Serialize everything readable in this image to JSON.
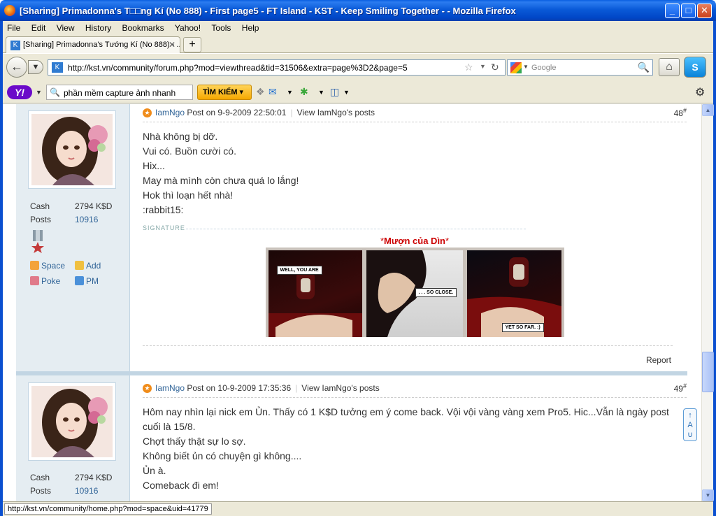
{
  "window": {
    "title": "[Sharing] Primadonna's T□□ng Kí (No 888) - First page5 - FT Island - KST - Keep Smiling Together - - Mozilla Firefox",
    "min": "_",
    "max": "□",
    "close": "✕"
  },
  "menu": [
    "File",
    "Edit",
    "View",
    "History",
    "Bookmarks",
    "Yahoo!",
    "Tools",
    "Help"
  ],
  "tab": {
    "label": "[Sharing] Primadonna's Tướng Kí (No 888) - ...",
    "close": "✕",
    "new": "+"
  },
  "nav": {
    "url": "http://kst.vn/community/forum.php?mod=viewthread&tid=31506&extra=page%3D2&page=5",
    "search_placeholder": "Google"
  },
  "yahoo": {
    "logo": "Y!",
    "search_value": "phần mềm capture ảnh nhanh",
    "search_button": "TÌM KIẾM ▾"
  },
  "posts": [
    {
      "author": "IamNgo",
      "posted": " Post on 9-9-2009 22:50:01",
      "view_posts": "View IamNgo's posts",
      "floor": "48",
      "cash_label": "Cash",
      "cash_value": "2794 K$D",
      "posts_label": "Posts",
      "posts_value": "10916",
      "actions": [
        "Space",
        "Add",
        "Poke",
        "PM"
      ],
      "lines": [
        "Nhà không bị dỡ.",
        "Vui có. Buồn cười có.",
        "Hix...",
        "May mà mình còn chưa quá lo lắng!",
        "Hok thì loạn hết nhà!",
        ":rabbit15:"
      ],
      "signature_label": "SIGNATURE",
      "signature_title": "Mượn của Dìn",
      "comic_bubbles": [
        "WELL, YOU ARE",
        ". . . SO CLOSE.",
        "YET SO FAR. :)"
      ],
      "report": "Report"
    },
    {
      "author": "IamNgo",
      "posted": " Post on 10-9-2009 17:35:36",
      "view_posts": "View IamNgo's posts",
      "floor": "49",
      "cash_label": "Cash",
      "cash_value": "2794 K$D",
      "posts_label": "Posts",
      "posts_value": "10916",
      "lines": [
        "Hôm nay nhìn lại nick em Ủn. Thấy có 1 K$D tưởng em ý come back. Vội vội vàng vàng xem Pro5. Hic...Vẫn là ngày post cuối là 15/8.",
        "Chợt thấy thật sự lo sợ.",
        "Không biết ủn có chuyện gì không....",
        "Ủn à.",
        "Comeback đi em!"
      ]
    }
  ],
  "status": "http://kst.vn/community/home.php?mod=space&uid=41779"
}
